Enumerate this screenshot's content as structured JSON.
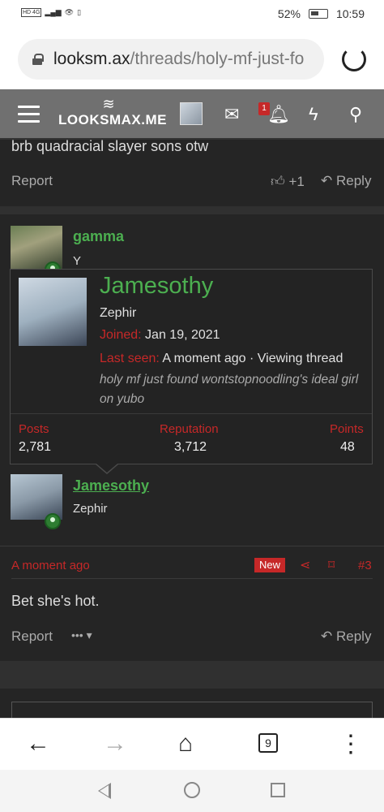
{
  "status_bar": {
    "network": "HD 4G",
    "battery": "52%",
    "time": "10:59"
  },
  "url_bar": {
    "host": "looksm.ax",
    "path": "/threads/holy-mf-just-fo"
  },
  "site_header": {
    "logo": "LOOKSMAX.ME",
    "notification_count": "1"
  },
  "post_top": {
    "text": "brb quadracial slayer sons otw",
    "report": "Report",
    "like_count": "+1",
    "reply": "Reply"
  },
  "post_gamma": {
    "username": "gamma",
    "text": "Y"
  },
  "tooltip": {
    "name": "Jamesothy",
    "title": "Zephir",
    "joined_label": "Joined:",
    "joined_value": "Jan 19, 2021",
    "last_seen_label": "Last seen:",
    "last_seen_value": "A moment ago · Viewing thread",
    "status": "holy mf just found wontstopnoodling's ideal girl on yubo",
    "stats": {
      "posts_label": "Posts",
      "posts": "2,781",
      "reputation_label": "Reputation",
      "reputation": "3,712",
      "points_label": "Points",
      "points": "48"
    }
  },
  "post_3": {
    "username": "Jamesothy",
    "user_title": "Zephir",
    "time": "A moment ago",
    "new_badge": "New",
    "number": "#3",
    "text": "Bet she's hot.",
    "report": "Report",
    "more": "•••",
    "reply": "Reply"
  },
  "bottom_nav": {
    "tab_count": "9"
  }
}
